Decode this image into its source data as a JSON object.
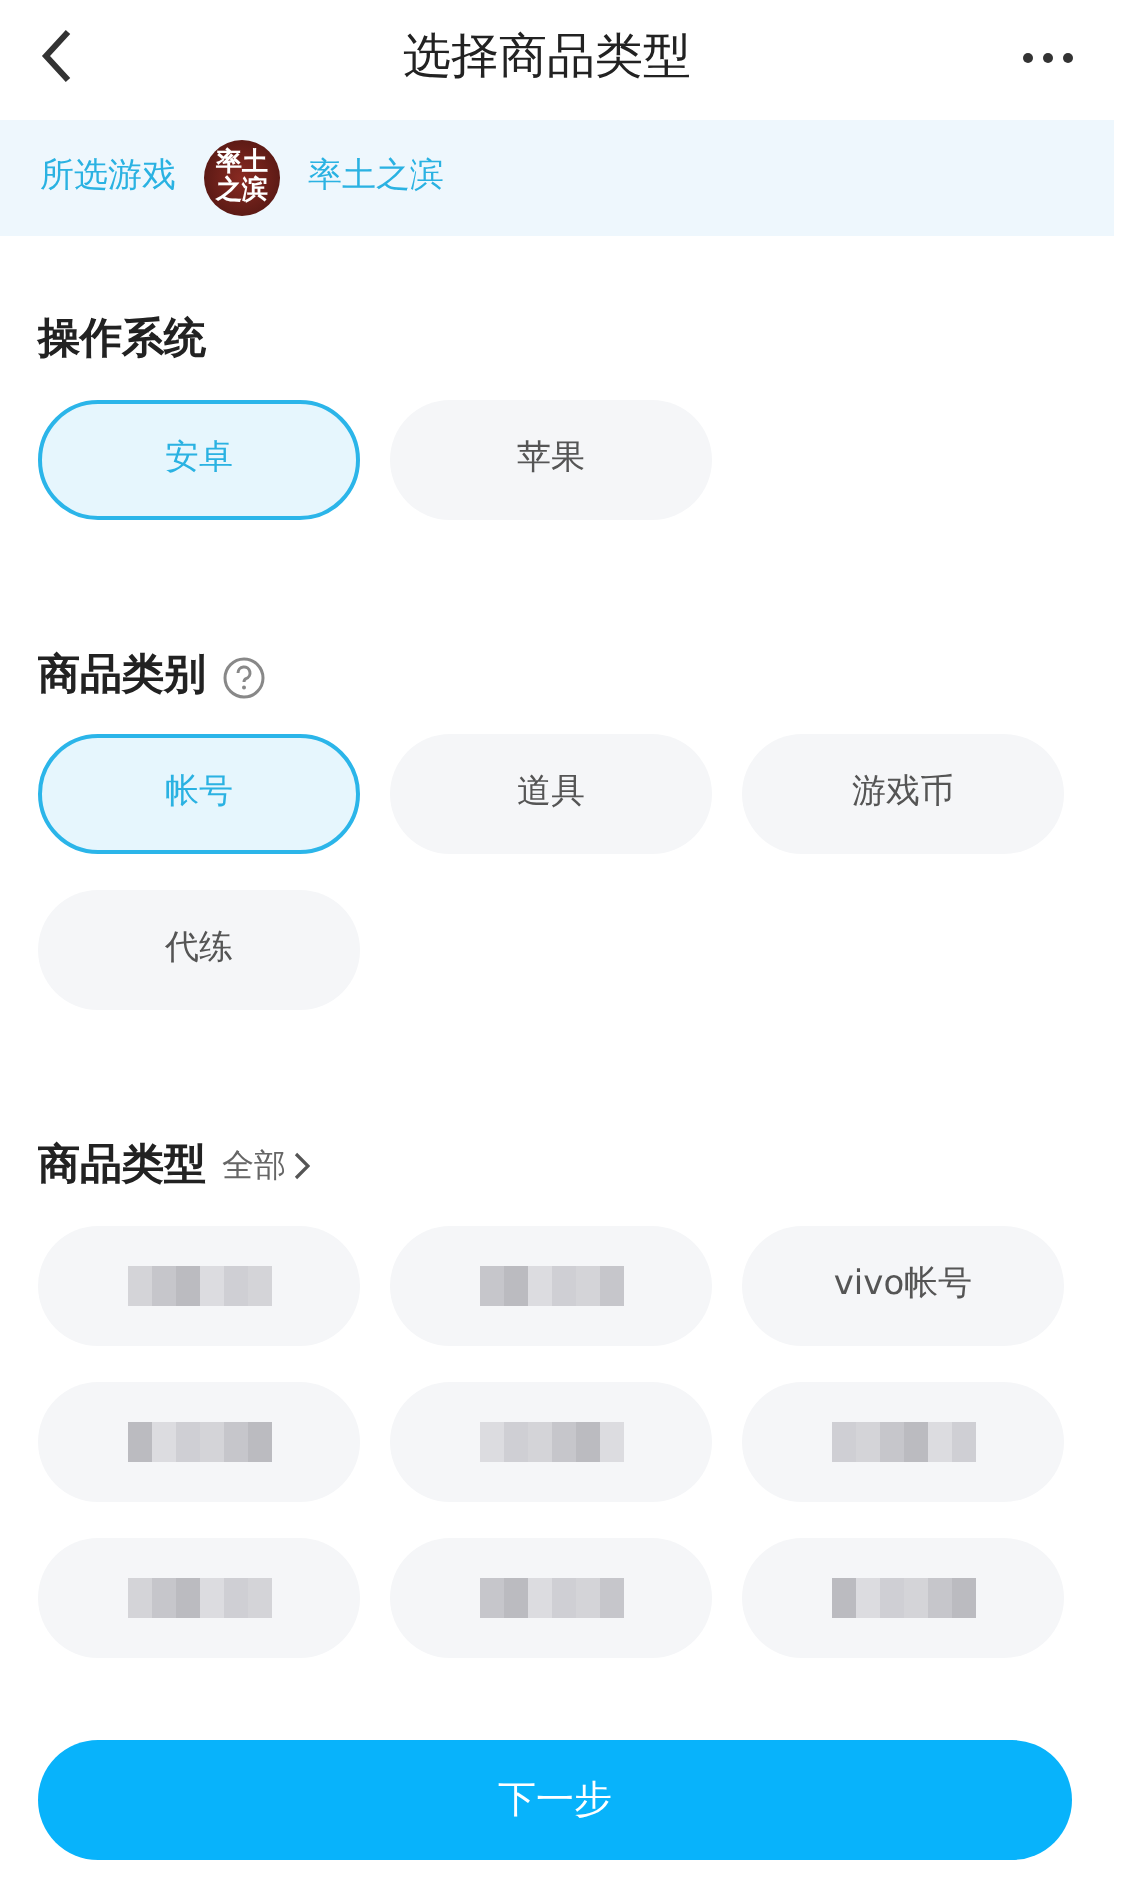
{
  "header": {
    "title": "选择商品类型"
  },
  "game": {
    "label": "所选游戏",
    "logo_lines": [
      "率土",
      "之滨"
    ],
    "name": "率土之滨"
  },
  "sections": [
    {
      "title": "操作系统",
      "help": false,
      "options": [
        {
          "kind": "text",
          "label": "安卓",
          "selected": true
        },
        {
          "kind": "text",
          "label": "苹果",
          "selected": false
        }
      ]
    },
    {
      "title": "商品类别",
      "help": true,
      "options": [
        {
          "kind": "text",
          "label": "帐号",
          "selected": true
        },
        {
          "kind": "text",
          "label": "道具",
          "selected": false
        },
        {
          "kind": "text",
          "label": "游戏币",
          "selected": false
        },
        {
          "kind": "text",
          "label": "代练",
          "selected": false
        }
      ]
    },
    {
      "title": "商品类型",
      "help": false,
      "link": "全部",
      "options": [
        {
          "kind": "blurred",
          "selected": false
        },
        {
          "kind": "blurred",
          "selected": false
        },
        {
          "kind": "text",
          "label": "vivo帐号",
          "selected": false
        },
        {
          "kind": "blurred",
          "selected": false
        },
        {
          "kind": "blurred",
          "selected": false
        },
        {
          "kind": "blurred",
          "selected": false
        },
        {
          "kind": "blurred",
          "selected": false
        },
        {
          "kind": "blurred",
          "selected": false
        },
        {
          "kind": "blurred",
          "selected": false
        }
      ]
    }
  ],
  "next_button": "下一步"
}
